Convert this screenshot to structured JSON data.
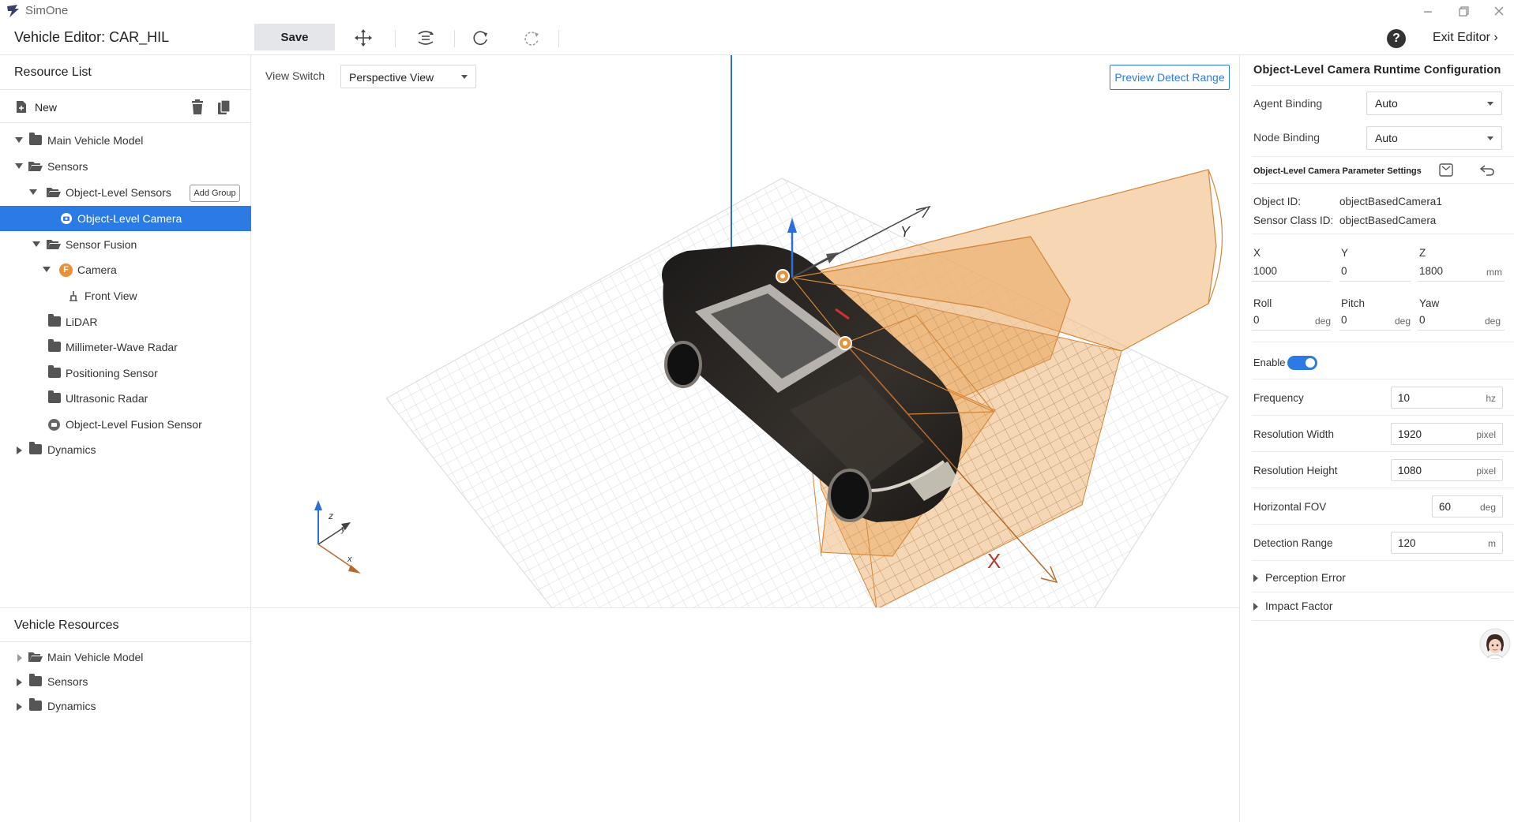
{
  "app": {
    "name": "SimOne",
    "window_title": "Vehicle Editor: CAR_HIL"
  },
  "toolbar": {
    "save_label": "Save",
    "exit_label": "Exit Editor",
    "help_label": "?"
  },
  "resource_list": {
    "title": "Resource List",
    "new_label": "New",
    "add_group_label": "Add Group",
    "items": [
      {
        "label": "Main Vehicle Model"
      },
      {
        "label": "Sensors"
      },
      {
        "label": "Object-Level Sensors"
      },
      {
        "label": "Object-Level Camera"
      },
      {
        "label": "Sensor Fusion"
      },
      {
        "label": "Camera",
        "badge": "F"
      },
      {
        "label": "Front View"
      },
      {
        "label": "LiDAR"
      },
      {
        "label": "Millimeter-Wave Radar"
      },
      {
        "label": "Positioning Sensor"
      },
      {
        "label": "Ultrasonic Radar"
      },
      {
        "label": "Object-Level Fusion Sensor"
      },
      {
        "label": "Dynamics"
      }
    ]
  },
  "vehicle_resources": {
    "title": "Vehicle Resources",
    "items": [
      {
        "label": "Main Vehicle Model"
      },
      {
        "label": "Sensors"
      },
      {
        "label": "Dynamics"
      }
    ]
  },
  "viewport": {
    "view_switch_label": "View Switch",
    "view_value": "Perspective View",
    "preview_label": "Preview Detect Range",
    "axis_labels": {
      "y": "Y",
      "x": "X",
      "gizmo_z": "z",
      "gizmo_y": "y",
      "gizmo_x": "x"
    }
  },
  "config": {
    "title": "Object-Level Camera Runtime Configuration",
    "agent_binding_label": "Agent Binding",
    "agent_binding_value": "Auto",
    "node_binding_label": "Node Binding",
    "node_binding_value": "Auto",
    "param_settings_title": "Object-Level Camera Parameter Settings",
    "object_id_label": "Object ID:",
    "object_id_value": "objectBasedCamera1",
    "sensor_class_label": "Sensor Class ID:",
    "sensor_class_value": "objectBasedCamera",
    "x_label": "X",
    "x_value": "1000",
    "y_label": "Y",
    "y_value": "0",
    "z_label": "Z",
    "z_value": "1800",
    "pos_unit": "mm",
    "roll_label": "Roll",
    "roll_value": "0",
    "pitch_label": "Pitch",
    "pitch_value": "0",
    "yaw_label": "Yaw",
    "yaw_value": "0",
    "angle_unit": "deg",
    "enable_label": "Enable",
    "frequency_label": "Frequency",
    "frequency_value": "10",
    "frequency_unit": "hz",
    "res_width_label": "Resolution Width",
    "res_width_value": "1920",
    "res_unit": "pixel",
    "res_height_label": "Resolution Height",
    "res_height_value": "1080",
    "hfov_label": "Horizontal FOV",
    "hfov_value": "60",
    "hfov_unit": "deg",
    "range_label": "Detection Range",
    "range_value": "120",
    "range_unit": "m",
    "perception_error_label": "Perception Error",
    "impact_factor_label": "Impact Factor"
  },
  "colors": {
    "accent": "#2c7be5",
    "fov": "#e8a050",
    "fov_stroke": "#d4863a",
    "car": "#2b2623"
  }
}
